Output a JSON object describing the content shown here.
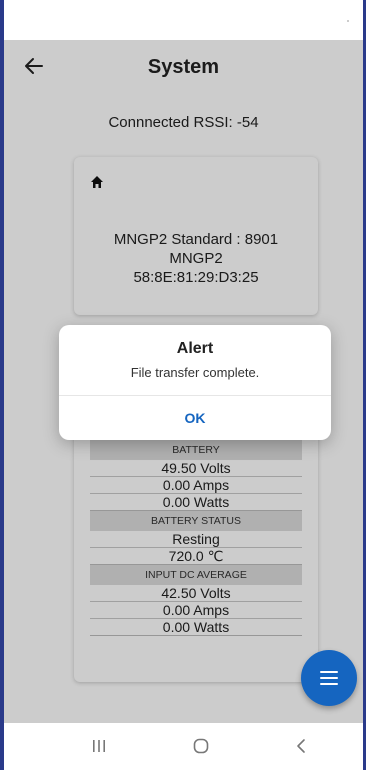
{
  "app": {
    "title": "System",
    "back_icon": "arrow-left-icon"
  },
  "rssi_text": "Connnected RSSI: -54",
  "device": {
    "icon": "home-icon",
    "model_line": "MNGP2 Standard : 8901",
    "name": "MNGP2",
    "mac": "58:8E:81:29:D3:25"
  },
  "stats": {
    "battery": {
      "header": "BATTERY",
      "volts": "49.50 Volts",
      "amps": "0.00 Amps",
      "watts": "0.00 Watts"
    },
    "battery_status": {
      "header": "BATTERY STATUS",
      "state": "Resting",
      "temperature": "720.0 ℃"
    },
    "input_dc_average": {
      "header": "INPUT DC AVERAGE",
      "volts": "42.50 Volts",
      "amps": "0.00 Amps",
      "watts": "0.00 Watts"
    }
  },
  "dialog": {
    "title": "Alert",
    "message": "File transfer complete.",
    "ok_label": "OK"
  },
  "fab": {
    "icon": "menu-icon"
  },
  "nav": {
    "recents_icon": "recents-icon",
    "home_icon": "home-circle-icon",
    "back_icon": "chevron-left-icon"
  },
  "colors": {
    "accent": "#1565c0",
    "frame": "#2a3a8a",
    "section_header": "#dcdcdc"
  }
}
